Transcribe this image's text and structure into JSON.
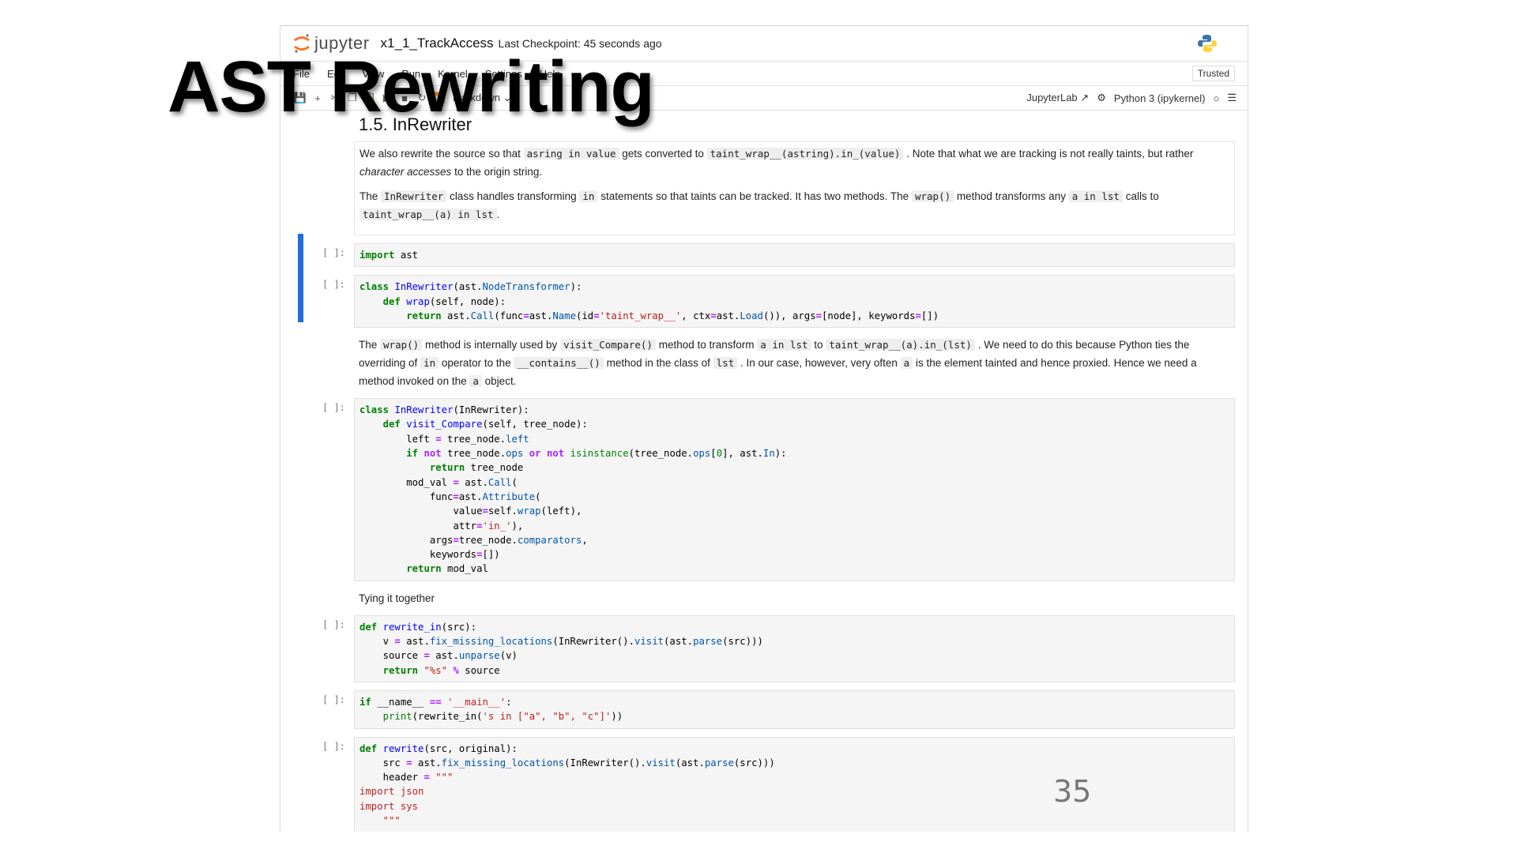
{
  "slide": {
    "title": "AST Rewriting",
    "page_number": "35"
  },
  "jupyter": {
    "logo_text": "jupyter",
    "notebook_name": "x1_1_TrackAccess",
    "checkpoint": "Last Checkpoint: 45 seconds ago",
    "menu": [
      "File",
      "Edit",
      "View",
      "Run",
      "Kernel",
      "Settings",
      "Help"
    ],
    "trusted": "Trusted",
    "celltype": "Markdown",
    "jupyterlab_link": "JupyterLab",
    "kernel": "Python 3 (ipykernel)"
  },
  "cells": {
    "heading": "1.5. InRewriter",
    "md1": {
      "p1a": "We also rewrite the source so that",
      "p1c1": "asring in value",
      "p1b": "gets converted to",
      "p1c2": "taint_wrap__(astring).in_(value)",
      "p1d": ". Note that what we are tracking is not really taints, but rather",
      "p1em": "character accesses",
      "p1e": "to the origin string.",
      "p2a": "The",
      "p2c1": "InRewriter",
      "p2b": "class handles transforming",
      "p2c2": "in",
      "p2d": "statements so that taints can be tracked. It has two methods. The",
      "p2c3": "wrap()",
      "p2e": "method transforms any",
      "p2c4": "a in lst",
      "p2f": "calls to",
      "p2c5": "taint_wrap__(a) in lst",
      "p2g": "."
    },
    "md2": {
      "a": "The",
      "c1": "wrap()",
      "b": "method is internally used by",
      "c2": "visit_Compare()",
      "c": "method to transform",
      "c3": "a in lst",
      "d": "to",
      "c4": "taint_wrap__(a).in_(lst)",
      "e": ". We need to do this because Python ties the overriding of",
      "c5": "in",
      "f": "operator to the",
      "c6": "__contains__()",
      "g": "method in the class of",
      "c7": "lst",
      "h": ". In our case, however, very often",
      "c8": "a",
      "i": "is the element tainted and hence proxied. Hence we need a method invoked on the",
      "c9": "a",
      "j": "object."
    },
    "md3": "Tying it together",
    "prompt": "[ ]:"
  }
}
